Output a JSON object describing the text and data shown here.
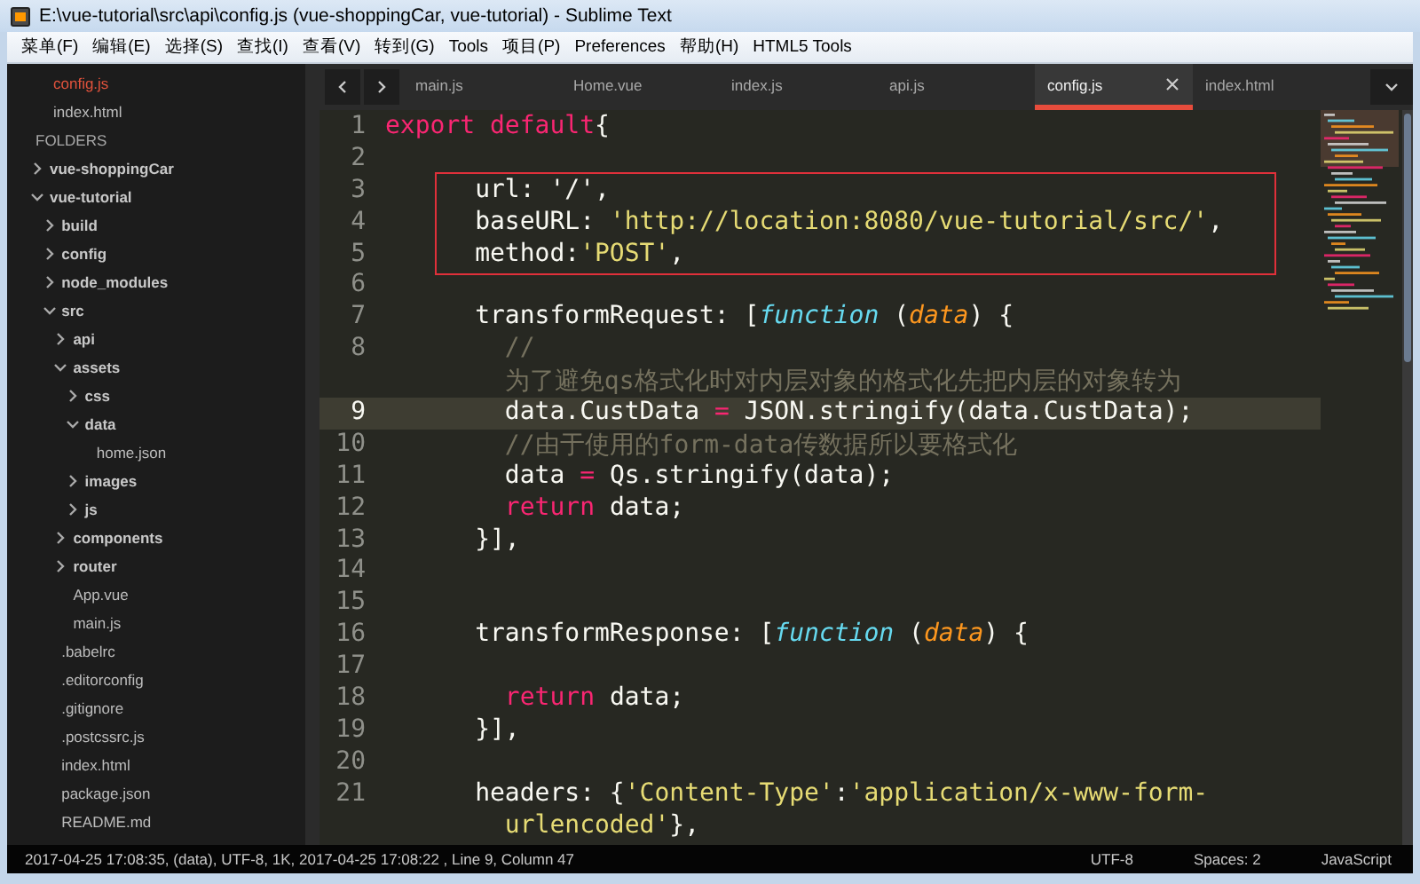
{
  "window": {
    "title": "E:\\vue-tutorial\\src\\api\\config.js (vue-shoppingCar, vue-tutorial) - Sublime Text"
  },
  "menu": [
    "菜单(F)",
    "编辑(E)",
    "选择(S)",
    "查找(I)",
    "查看(V)",
    "转到(G)",
    "Tools",
    "项目(P)",
    "Preferences",
    "帮助(H)",
    "HTML5 Tools"
  ],
  "sidebar": {
    "open_files": [
      {
        "name": "config.js",
        "selected": true
      },
      {
        "name": "index.html",
        "selected": false
      }
    ],
    "folders_label": "FOLDERS",
    "tree": [
      {
        "name": "vue-shoppingCar",
        "kind": "folder",
        "expanded": false
      },
      {
        "name": "vue-tutorial",
        "kind": "folder",
        "expanded": true,
        "children": [
          {
            "name": "build",
            "kind": "folder",
            "expanded": false
          },
          {
            "name": "config",
            "kind": "folder",
            "expanded": false
          },
          {
            "name": "node_modules",
            "kind": "folder",
            "expanded": false
          },
          {
            "name": "src",
            "kind": "folder",
            "expanded": true,
            "children": [
              {
                "name": "api",
                "kind": "folder",
                "expanded": false
              },
              {
                "name": "assets",
                "kind": "folder",
                "expanded": true,
                "children": [
                  {
                    "name": "css",
                    "kind": "folder",
                    "expanded": false
                  },
                  {
                    "name": "data",
                    "kind": "folder",
                    "expanded": true,
                    "children": [
                      {
                        "name": "home.json",
                        "kind": "file"
                      }
                    ]
                  },
                  {
                    "name": "images",
                    "kind": "folder",
                    "expanded": false
                  },
                  {
                    "name": "js",
                    "kind": "folder",
                    "expanded": false
                  }
                ]
              },
              {
                "name": "components",
                "kind": "folder",
                "expanded": false
              },
              {
                "name": "router",
                "kind": "folder",
                "expanded": false
              },
              {
                "name": "App.vue",
                "kind": "file"
              },
              {
                "name": "main.js",
                "kind": "file"
              }
            ]
          },
          {
            "name": ".babelrc",
            "kind": "file"
          },
          {
            "name": ".editorconfig",
            "kind": "file"
          },
          {
            "name": ".gitignore",
            "kind": "file"
          },
          {
            "name": ".postcssrc.js",
            "kind": "file"
          },
          {
            "name": "index.html",
            "kind": "file"
          },
          {
            "name": "package.json",
            "kind": "file"
          },
          {
            "name": "README.md",
            "kind": "file"
          }
        ]
      }
    ]
  },
  "tabs": [
    {
      "label": "main.js",
      "selected": false
    },
    {
      "label": "Home.vue",
      "selected": false
    },
    {
      "label": "index.js",
      "selected": false
    },
    {
      "label": "api.js",
      "selected": false
    },
    {
      "label": "config.js",
      "selected": true
    },
    {
      "label": "index.html",
      "selected": false
    }
  ],
  "lines": [
    {
      "number": "1",
      "current": false,
      "boxed": false,
      "tokens": [
        {
          "kind": "keyword",
          "text": "export default"
        },
        {
          "kind": "plain",
          "text": "{"
        }
      ]
    },
    {
      "number": "2",
      "current": false,
      "boxed": false
    },
    {
      "number": "3",
      "current": false,
      "boxed": true,
      "tokens": [
        {
          "kind": "plain",
          "text": "      url: '/',"
        }
      ]
    },
    {
      "number": "4",
      "current": false,
      "boxed": true,
      "tokens": [
        {
          "kind": "plain",
          "text": "      baseURL: "
        },
        {
          "kind": "string",
          "text": "'http://location:8080/vue-tutorial/src/'"
        },
        {
          "kind": "plain",
          "text": ","
        }
      ]
    },
    {
      "number": "5",
      "current": false,
      "boxed": true,
      "tokens": [
        {
          "kind": "plain",
          "text": "      method:"
        },
        {
          "kind": "string",
          "text": "'POST'"
        },
        {
          "kind": "plain",
          "text": ","
        }
      ]
    },
    {
      "number": "6",
      "current": false,
      "boxed": false
    },
    {
      "number": "7",
      "current": false,
      "boxed": false,
      "tokens": [
        {
          "kind": "plain",
          "text": "      transformRequest: ["
        },
        {
          "kind": "function",
          "text": "function"
        },
        {
          "kind": "plain",
          "text": " ("
        },
        {
          "kind": "param",
          "text": "data"
        },
        {
          "kind": "plain",
          "text": ") {"
        }
      ]
    },
    {
      "number": "8",
      "current": false,
      "boxed": false,
      "tokens": [
        {
          "kind": "comment",
          "text": "        //"
        }
      ]
    },
    {
      "current": false,
      "boxed": false,
      "tokens": [
        {
          "kind": "comment",
          "text": "        为了避免qs格式化时对内层对象的格式化先把内层的对象转为"
        }
      ]
    },
    {
      "number": "9",
      "current": true,
      "boxed": false,
      "tokens": [
        {
          "kind": "plain",
          "text": "        data.CustData "
        },
        {
          "kind": "keyword",
          "text": "="
        },
        {
          "kind": "plain",
          "text": " JSON.stringify(data.CustData);"
        }
      ]
    },
    {
      "number": "10",
      "current": false,
      "boxed": false,
      "tokens": [
        {
          "kind": "comment",
          "text": "        //由于使用的form-data传数据所以要格式化"
        }
      ]
    },
    {
      "number": "11",
      "current": false,
      "boxed": false,
      "tokens": [
        {
          "kind": "plain",
          "text": "        data "
        },
        {
          "kind": "keyword",
          "text": "="
        },
        {
          "kind": "plain",
          "text": " Qs.stringify(data);"
        }
      ]
    },
    {
      "number": "12",
      "current": false,
      "boxed": false,
      "tokens": [
        {
          "kind": "keyword",
          "text": "        return"
        },
        {
          "kind": "plain",
          "text": " data;"
        }
      ]
    },
    {
      "number": "13",
      "current": false,
      "boxed": false,
      "tokens": [
        {
          "kind": "plain",
          "text": "      }],"
        }
      ]
    },
    {
      "number": "14",
      "current": false,
      "boxed": false
    },
    {
      "number": "15",
      "current": false,
      "boxed": false
    },
    {
      "number": "16",
      "current": false,
      "boxed": false,
      "tokens": [
        {
          "kind": "plain",
          "text": "      transformResponse: ["
        },
        {
          "kind": "function",
          "text": "function"
        },
        {
          "kind": "plain",
          "text": " ("
        },
        {
          "kind": "param",
          "text": "data"
        },
        {
          "kind": "plain",
          "text": ") {"
        }
      ]
    },
    {
      "number": "17",
      "current": false,
      "boxed": false
    },
    {
      "number": "18",
      "current": false,
      "boxed": false,
      "tokens": [
        {
          "kind": "keyword",
          "text": "        return"
        },
        {
          "kind": "plain",
          "text": " data;"
        }
      ]
    },
    {
      "number": "19",
      "current": false,
      "boxed": false,
      "tokens": [
        {
          "kind": "plain",
          "text": "      }],"
        }
      ]
    },
    {
      "number": "20",
      "current": false,
      "boxed": false
    },
    {
      "number": "21",
      "current": false,
      "boxed": false,
      "tokens": [
        {
          "kind": "plain",
          "text": "      headers: {"
        },
        {
          "kind": "string",
          "text": "'Content-Type'"
        },
        {
          "kind": "plain",
          "text": ":"
        },
        {
          "kind": "string",
          "text": "'application/x-www-form-"
        }
      ]
    },
    {
      "current": false,
      "boxed": false,
      "tokens": [
        {
          "kind": "string",
          "text": "        urlencoded'"
        },
        {
          "kind": "plain",
          "text": "},"
        }
      ]
    }
  ],
  "status_bar": {
    "info": "2017-04-25 17:08:35, (data), UTF-8, 1K, 2017-04-25 17:08:22 , Line 9, Column 47",
    "encoding": "UTF-8",
    "indentation": "Spaces: 2",
    "syntax": "JavaScript"
  }
}
